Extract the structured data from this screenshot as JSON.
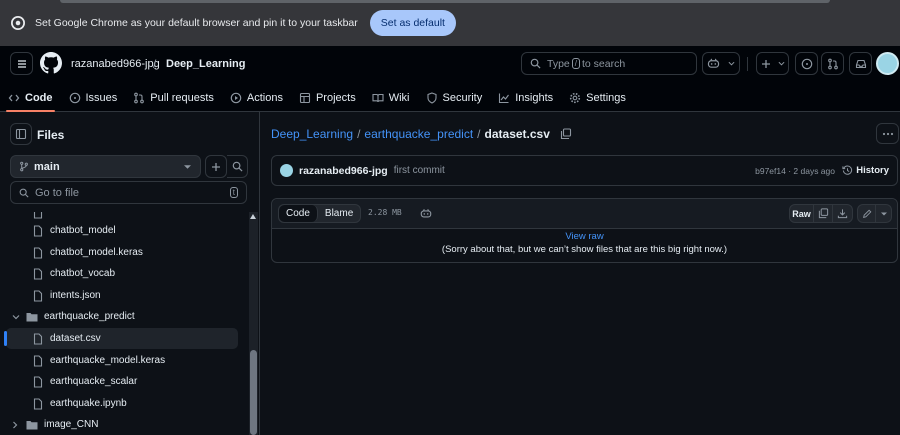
{
  "infobar": {
    "message": "Set Google Chrome as your default browser and pin it to your taskbar",
    "button": "Set as default"
  },
  "header": {
    "owner": "razanabed966-jpg",
    "separator": "/",
    "repo": "Deep_Learning",
    "search_pre": "Type",
    "search_key": "/",
    "search_post": "to search"
  },
  "tabs": [
    {
      "label": "Code",
      "icon": "code-icon"
    },
    {
      "label": "Issues",
      "icon": "issue-icon"
    },
    {
      "label": "Pull requests",
      "icon": "git-pull-request-icon"
    },
    {
      "label": "Actions",
      "icon": "play-icon"
    },
    {
      "label": "Projects",
      "icon": "table-icon"
    },
    {
      "label": "Wiki",
      "icon": "book-icon"
    },
    {
      "label": "Security",
      "icon": "shield-icon"
    },
    {
      "label": "Insights",
      "icon": "graph-icon"
    },
    {
      "label": "Settings",
      "icon": "gear-icon"
    }
  ],
  "sidebar": {
    "title": "Files",
    "branch": "main",
    "goto_placeholder": "Go to file",
    "goto_key": "t",
    "tree": [
      {
        "label": "chatbot_model",
        "type": "file"
      },
      {
        "label": "chatbot_model.keras",
        "type": "file"
      },
      {
        "label": "chatbot_vocab",
        "type": "file"
      },
      {
        "label": "intents.json",
        "type": "file"
      },
      {
        "label": "earthquacke_predict",
        "type": "folder-open"
      },
      {
        "label": "dataset.csv",
        "type": "file",
        "selected": true
      },
      {
        "label": "earthquacke_model.keras",
        "type": "file"
      },
      {
        "label": "earthquacke_scalar",
        "type": "file"
      },
      {
        "label": "earthquake.ipynb",
        "type": "file"
      },
      {
        "label": "image_CNN",
        "type": "folder-closed"
      }
    ]
  },
  "breadcrumb": {
    "repo": "Deep_Learning",
    "sep1": "/",
    "folder": "earthquacke_predict",
    "sep2": "/",
    "file": "dataset.csv"
  },
  "commit": {
    "author": "razanabed966-jpg",
    "message": "first commit",
    "meta": "b97ef14 · 2 days ago",
    "history": "History"
  },
  "file": {
    "tab_code": "Code",
    "tab_blame": "Blame",
    "size": "2.28 MB",
    "raw": "Raw",
    "view_raw": "View raw",
    "too_big": "(Sorry about that, but we can’t show files that are this big right now.)"
  },
  "colors": {
    "accent": "#4493f8",
    "tab_underline": "#f78166",
    "background": "#0d1117"
  }
}
